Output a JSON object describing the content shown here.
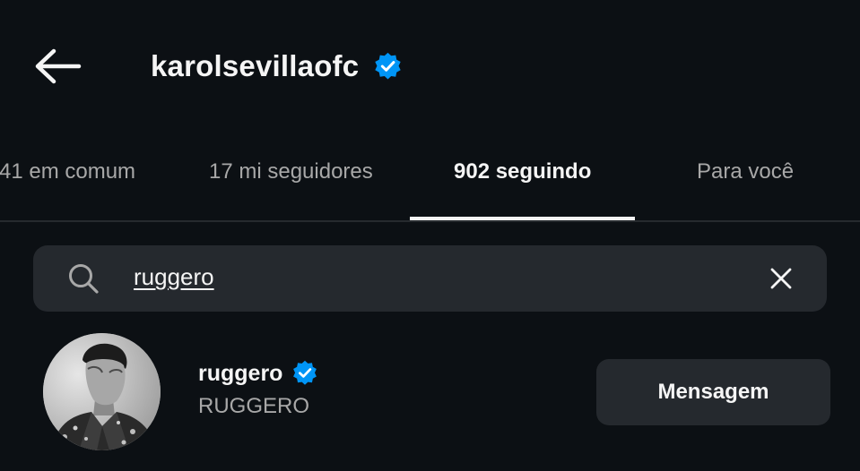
{
  "header": {
    "title": "karolsevillaofc",
    "back_icon": "arrow-left-icon",
    "verified_icon": "verified-badge-icon"
  },
  "tabs": [
    {
      "label": "41 em comum",
      "active": false
    },
    {
      "label": "17 mi seguidores",
      "active": false
    },
    {
      "label": "902 seguindo",
      "active": true
    },
    {
      "label": "Para você",
      "active": false
    }
  ],
  "search": {
    "value": "ruggero",
    "icon": "search-icon",
    "clear_icon": "close-icon"
  },
  "results": [
    {
      "username": "ruggero",
      "full_name": "RUGGERO",
      "verified": true,
      "button_label": "Mensagem"
    }
  ],
  "colors": {
    "background": "#0c1014",
    "text_primary": "#f5f5f5",
    "text_secondary": "#a8a8a8",
    "surface": "#25292e",
    "verified_blue": "#0095f6"
  }
}
